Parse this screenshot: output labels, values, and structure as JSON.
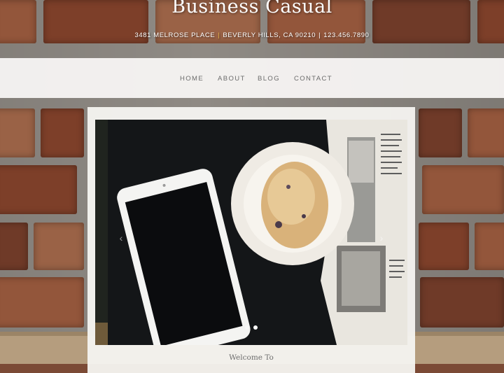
{
  "site": {
    "brand": "Business Casual",
    "address": {
      "street": "3481 MELROSE PLACE",
      "city": "BEVERLY HILLS, CA 90210",
      "phone": "123.456.7890"
    },
    "separator": "|"
  },
  "nav": {
    "items": [
      {
        "label": "HOME"
      },
      {
        "label": "ABOUT"
      },
      {
        "label": "BLOG"
      },
      {
        "label": "CONTACT"
      }
    ]
  },
  "carousel": {
    "prev_icon": "chevron-left-icon",
    "next_icon": "chevron-right-icon",
    "prev_glyph": "‹",
    "next_glyph": "›",
    "slide_count": 2,
    "active_slide": 2
  },
  "intro": {
    "heading": "Welcome To"
  },
  "colors": {
    "separator_accent": "#e6b54a",
    "nav_text": "#6b6b6b",
    "content_background": "#f6f4f1"
  }
}
